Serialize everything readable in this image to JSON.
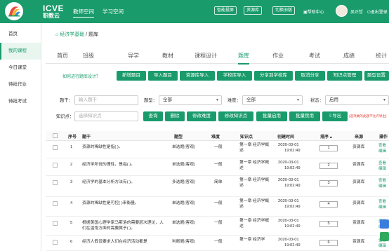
{
  "header": {
    "brand_line1": "ICVE",
    "brand_line2": "职教云",
    "nav": [
      "教师空间",
      "学习空间"
    ],
    "buttons": [
      "智能投屏",
      "资源库",
      "切换旧版"
    ],
    "help": "帮助中心",
    "user_name": "吴正哲",
    "logout": "退出登录"
  },
  "sidebar": {
    "items": [
      "首页",
      "我的课程",
      "今日课堂",
      "待批作业",
      "待批考试"
    ]
  },
  "breadcrumb": {
    "course": "经济学基础",
    "sep": "/",
    "current": "题库"
  },
  "tabs": [
    "首页",
    "班级",
    "导学",
    "教材",
    "课程设计",
    "题库",
    "作业",
    "考试",
    "成绩",
    "统计"
  ],
  "toolbar": {
    "howto": "如何进行题库设计？",
    "buttons": [
      "新增题目",
      "导入题目",
      "资源库导入",
      "学校库导入",
      "分享到学校库",
      "取消分享",
      "知识点管理",
      "题型设置"
    ]
  },
  "filters": {
    "stem_label": "题干：",
    "stem_placeholder": "输入题干",
    "type_label": "题型：",
    "type_value": "全部",
    "difficulty_label": "难度：",
    "difficulty_value": "全部",
    "status_label": "状态：",
    "status_value": "启用",
    "knowledge_label": "知识点：",
    "knowledge_placeholder": "选择知识点",
    "actions": [
      "查询",
      "删除",
      "修改难度",
      "修改知识点",
      "批量启用",
      "批量禁用",
      "导出"
    ],
    "export_note": "(选项类的此题不允许导出)"
  },
  "table": {
    "headers": [
      "序号",
      "题干",
      "题型",
      "难度",
      "知识点",
      "创建时间",
      "排序",
      "来源",
      "操作"
    ],
    "rows": [
      {
        "no": "1",
        "stem": "资源的稀缺性是指( )。",
        "type": "单选题(客观)",
        "level": "一般",
        "kp": "第一章 经济学概述",
        "date": "2020-03-01",
        "time": "19:02:49",
        "sort": "1",
        "source": "资源库",
        "ops": [
          "查看",
          "编辑"
        ]
      },
      {
        "no": "2",
        "stem": "经济学所说的理性，是指( )。",
        "type": "单选题(客观)",
        "level": "一般",
        "kp": "第一章 经济学概述",
        "date": "2020-03-01",
        "time": "19:02:49",
        "sort": "2",
        "source": "资源库",
        "ops": [
          "查看",
          "编辑"
        ]
      },
      {
        "no": "3",
        "stem": "经济学的基本分析方法有( )。",
        "type": "多选题(客观)",
        "level": "简单",
        "kp": "第一章 经济学概述",
        "date": "2020-03-01",
        "time": "19:02:49",
        "sort": "3",
        "source": "资源库",
        "ops": [
          "查看",
          "编辑"
        ]
      },
      {
        "no": "4",
        "stem": "资源的稀缺性是可控( )来衡量。",
        "type": "单选题(客观)",
        "level": "一般",
        "kp": "第一章 经济学概述",
        "date": "2020-03-01",
        "time": "19:02:49",
        "sort": "4",
        "source": "资源库",
        "ops": [
          "查看",
          "编辑"
        ]
      },
      {
        "no": "5",
        "stem": "根据美国心理学家马斯洛的需要层次理论，人们在温饱方面的需要属于( )。",
        "type": "单选题(客观)",
        "level": "一般",
        "kp": "第一章 经济学概述",
        "date": "2020-03-01",
        "time": "19:02:49",
        "sort": "5",
        "source": "资源库",
        "ops": [
          "查看",
          "编辑"
        ]
      },
      {
        "no": "6",
        "stem": "经济人假设要求人们在经济活动都是",
        "type": "判断题(客观)",
        "level": "一般",
        "kp": "第一章 经济学",
        "date": "2020-03-01",
        "time": "19:02:49",
        "sort": "6",
        "source": "资源库",
        "ops": [
          "查看",
          "编辑"
        ]
      }
    ]
  },
  "colors": {
    "brand": "#1a9b6c",
    "note": "#e63a2e"
  }
}
